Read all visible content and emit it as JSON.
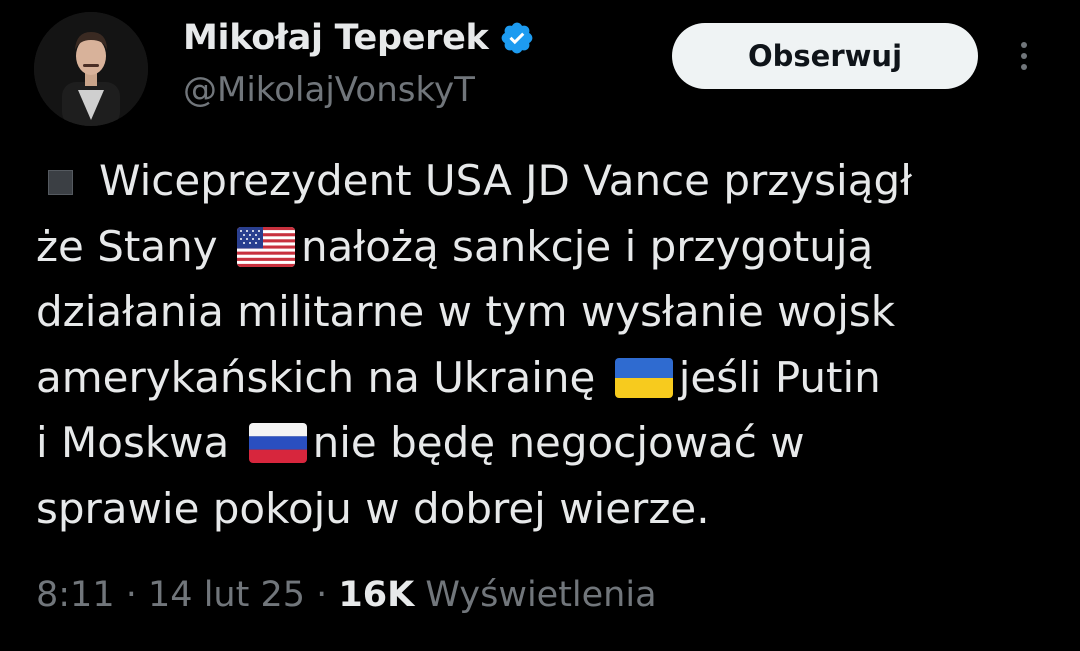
{
  "author": {
    "display_name": "Mikołaj Teperek",
    "handle": "@MikolajVonskyT",
    "verified": true,
    "avatar_icon": "avatar-photo"
  },
  "actions": {
    "follow_label": "Obserwuj",
    "more_icon": "more-vertical-icon"
  },
  "tweet": {
    "lines": [
      {
        "bullet": true,
        "parts": [
          "Wiceprezydent USA JD Vance przysiągł"
        ]
      },
      {
        "parts": [
          "że Stany ",
          "nałożą sankcje i przygotują"
        ],
        "flag": "us-flag-icon"
      },
      {
        "parts": [
          "działania militarne w tym wysłanie wojsk"
        ]
      },
      {
        "parts": [
          "amerykańskich na Ukrainę ",
          "jeśli Putin"
        ],
        "flag": "ukraine-flag-icon"
      },
      {
        "parts": [
          "i Moskwa ",
          "nie będę negocjować w"
        ],
        "flag": "russia-flag-icon"
      },
      {
        "parts": [
          "sprawie pokoju w dobrej wierze."
        ]
      }
    ]
  },
  "meta": {
    "time": "8:11",
    "separator": "·",
    "date": "14 lut 25",
    "views_count": "16K",
    "views_label": "Wyświetlenia"
  },
  "colors": {
    "background": "#000000",
    "text_primary": "#e7e9ea",
    "text_secondary": "#71767b",
    "verified_blue": "#1d9bf0",
    "button_bg": "#eff3f4"
  }
}
